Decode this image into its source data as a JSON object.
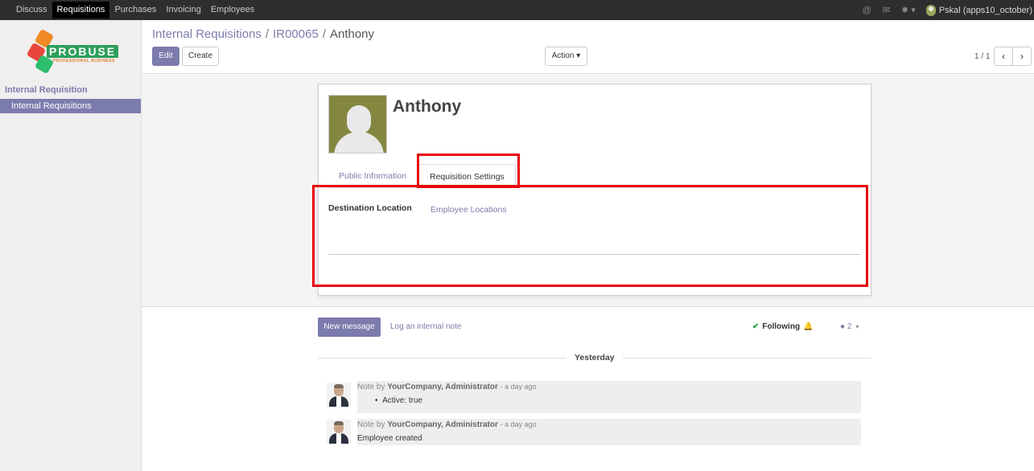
{
  "topnav": {
    "items": [
      "Discuss",
      "Requisitions",
      "Purchases",
      "Invoicing",
      "Employees"
    ],
    "active_index": 1,
    "user": "Pskal (apps10_october)"
  },
  "sidebar": {
    "logo_text": "PROBUSE",
    "logo_tagline": "PROFESSIONAL BUSINESS",
    "section": "Internal Requisition",
    "items": [
      "Internal Requisitions"
    ]
  },
  "breadcrumb": {
    "parts": [
      "Internal Requisitions",
      "IR00065"
    ],
    "current": "Anthony"
  },
  "buttons": {
    "edit": "Edit",
    "create": "Create",
    "action": "Action"
  },
  "pager": {
    "text": "1 / 1",
    "prev": "‹",
    "next": "›"
  },
  "form": {
    "name": "Anthony",
    "tabs": [
      "Public Information",
      "Requisition Settings"
    ],
    "active_tab": "Requisition Settings",
    "field_label": "Destination Location",
    "field_value": "Employee Locations"
  },
  "chatter": {
    "new_message": "New message",
    "log_note": "Log an internal note",
    "following": "Following",
    "followers_count": "2",
    "day_label": "Yesterday",
    "messages": [
      {
        "prefix": "Note by",
        "author": "YourCompany, Administrator",
        "ago": "- a day ago",
        "body": "Active: true"
      },
      {
        "prefix": "Note by",
        "author": "YourCompany, Administrator",
        "ago": "- a day ago",
        "body": "Employee created"
      }
    ]
  },
  "colors": {
    "accent": "#7c7bad",
    "highlight": "#e8000e",
    "topbar": "#2e2e2e"
  }
}
